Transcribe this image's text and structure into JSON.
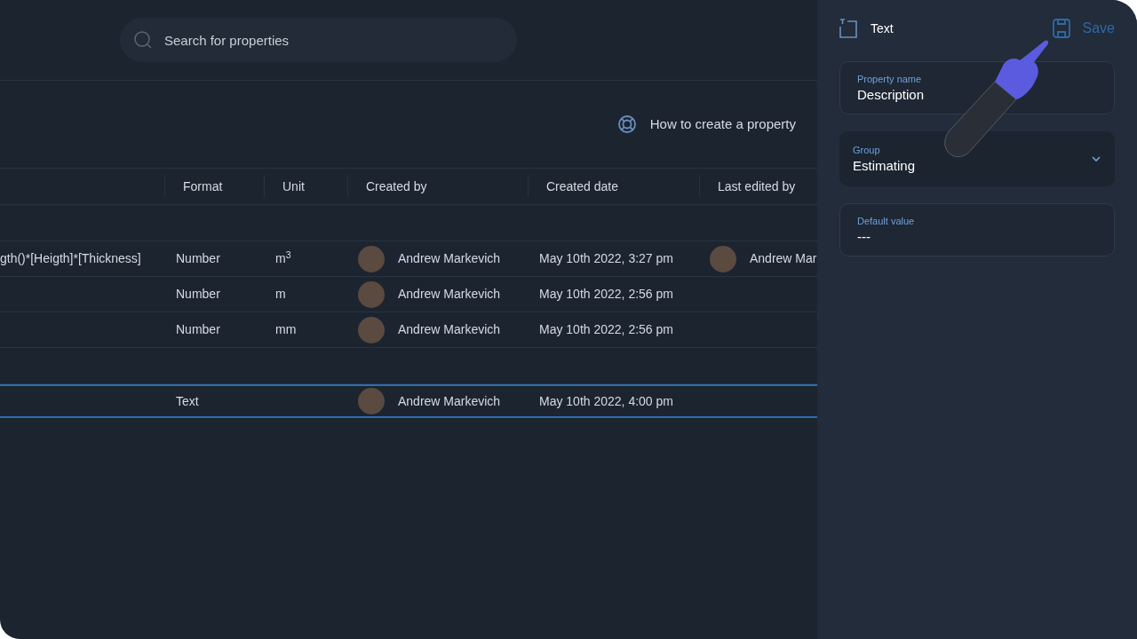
{
  "search": {
    "placeholder": "Search for properties"
  },
  "help_link": {
    "label": "How to create a property"
  },
  "table": {
    "columns": [
      "Format",
      "Unit",
      "Created by",
      "Created date",
      "Last edited by"
    ],
    "rows": [
      {
        "kind": "group",
        "selected": false
      },
      {
        "kind": "item",
        "selected": false,
        "formula": "gth()*[Heigth]*[Thickness]",
        "format": "Number",
        "unit": "m$^{3}$",
        "created_by": "Andrew Markevich",
        "created_date": "May 10th 2022, 3:27 pm",
        "last_edited_by": "Andrew Mar"
      },
      {
        "kind": "item",
        "selected": false,
        "format": "Number",
        "unit": "m",
        "created_by": "Andrew Markevich",
        "created_date": "May 10th 2022, 2:56 pm"
      },
      {
        "kind": "item",
        "selected": false,
        "format": "Number",
        "unit": "mm",
        "created_by": "Andrew Markevich",
        "created_date": "May 10th 2022, 2:56 pm"
      },
      {
        "kind": "group",
        "selected": false
      },
      {
        "kind": "item",
        "selected": true,
        "format": "Text",
        "created_by": "Andrew Markevich",
        "created_date": "May 10th 2022, 4:00 pm"
      }
    ]
  },
  "panel": {
    "type_label": "Text",
    "save": "Save",
    "fields": [
      {
        "kind": "input",
        "label": "Property name",
        "value": "Description"
      },
      {
        "kind": "select",
        "label": "Group",
        "value": "Estimating"
      },
      {
        "kind": "input",
        "label": "Default value",
        "value": "---"
      }
    ]
  }
}
